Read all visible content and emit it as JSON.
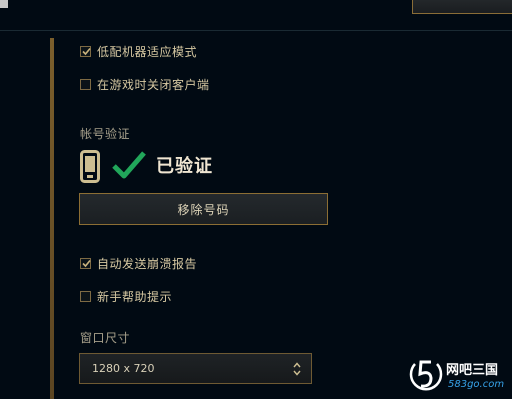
{
  "settings": {
    "low_spec_mode": {
      "label": "低配机器适应模式",
      "checked": true
    },
    "close_client_in_game": {
      "label": "在游戏时关闭客户端",
      "checked": false
    },
    "auto_send_crash": {
      "label": "自动发送崩溃报告",
      "checked": true
    },
    "newbie_tips": {
      "label": "新手帮助提示",
      "checked": false
    }
  },
  "account_verify": {
    "heading": "帐号验证",
    "status_text": "已验证",
    "remove_button_label": "移除号码"
  },
  "window_size": {
    "heading": "窗口尺寸",
    "selected_value": "1280 x 720"
  },
  "watermark": {
    "name": "网吧三国",
    "url": "583go.com"
  },
  "colors": {
    "background": "#010a13",
    "gold_border": "#8c6e34",
    "check_green": "#21a65a",
    "text": "#d6c8a2"
  }
}
